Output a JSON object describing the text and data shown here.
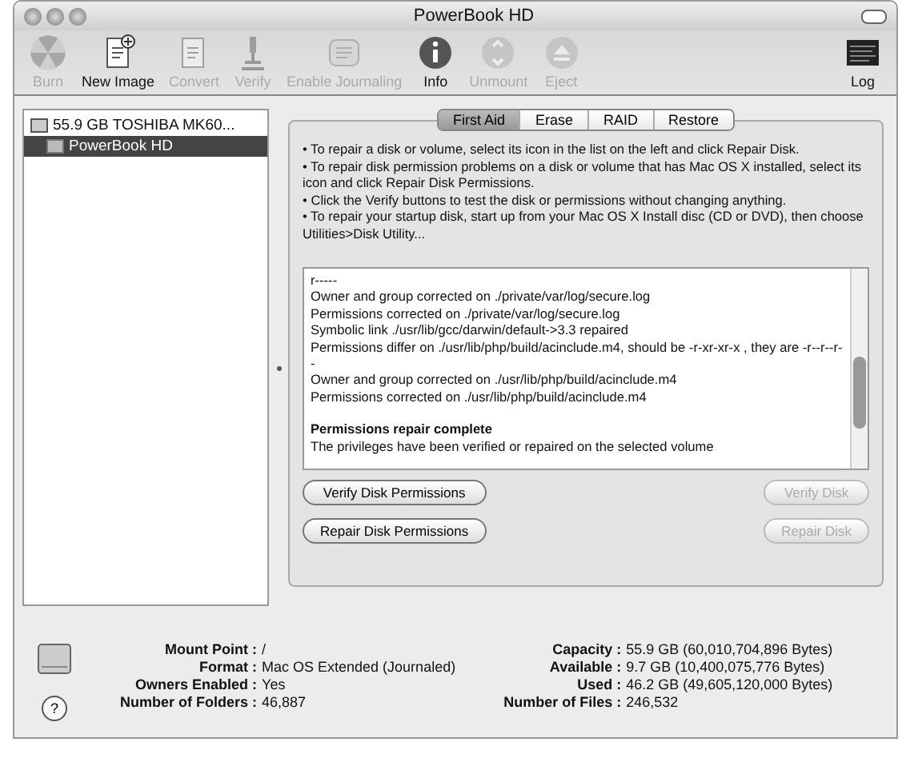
{
  "window": {
    "title": "PowerBook HD"
  },
  "toolbar": [
    {
      "label": "Burn",
      "disabled": true
    },
    {
      "label": "New Image",
      "disabled": false
    },
    {
      "label": "Convert",
      "disabled": true
    },
    {
      "label": "Verify",
      "disabled": true
    },
    {
      "label": "Enable Journaling",
      "disabled": true
    },
    {
      "label": "Info",
      "disabled": false
    },
    {
      "label": "Unmount",
      "disabled": true
    },
    {
      "label": "Eject",
      "disabled": true
    },
    {
      "label": "Log",
      "disabled": false
    }
  ],
  "sidebar": {
    "items": [
      {
        "label": "55.9 GB TOSHIBA MK60...",
        "selected": false,
        "children": [
          {
            "label": "PowerBook HD",
            "selected": true
          }
        ]
      }
    ]
  },
  "tabs": [
    {
      "label": "First Aid",
      "selected": true
    },
    {
      "label": "Erase",
      "selected": false
    },
    {
      "label": "RAID",
      "selected": false
    },
    {
      "label": "Restore",
      "selected": false
    }
  ],
  "instructions": [
    "• To repair a disk or volume, select its icon in the list on the left and click Repair Disk.",
    "• To repair disk permission problems on a disk or volume that has Mac OS X installed, select its icon and click Repair Disk Permissions.",
    "• Click the Verify buttons to test the disk or permissions without changing anything.",
    "• To repair your startup disk, start up from your Mac OS X Install disc (CD or DVD), then choose Utilities>Disk Utility..."
  ],
  "log": [
    {
      "kind": "line",
      "text": "r-----"
    },
    {
      "kind": "line",
      "text": "Owner and group corrected on ./private/var/log/secure.log"
    },
    {
      "kind": "line",
      "text": "Permissions corrected on ./private/var/log/secure.log"
    },
    {
      "kind": "line",
      "text": "Symbolic link ./usr/lib/gcc/darwin/default->3.3 repaired"
    },
    {
      "kind": "line",
      "text": "Permissions differ on ./usr/lib/php/build/acinclude.m4, should be -r-xr-xr-x , they are -r--r--r--"
    },
    {
      "kind": "line",
      "text": "Owner and group corrected on ./usr/lib/php/build/acinclude.m4"
    },
    {
      "kind": "line",
      "text": "Permissions corrected on ./usr/lib/php/build/acinclude.m4"
    },
    {
      "kind": "heading",
      "text": "Permissions repair complete"
    },
    {
      "kind": "line",
      "text": "The privileges have been verified or repaired on the selected volume"
    }
  ],
  "buttons": [
    {
      "label": "Verify Disk Permissions",
      "disabled": false
    },
    {
      "label": "Verify Disk",
      "disabled": true
    },
    {
      "label": "Repair Disk Permissions",
      "disabled": false
    },
    {
      "label": "Repair Disk",
      "disabled": true
    }
  ],
  "info_left": [
    {
      "label": "Mount Point :",
      "value": "/"
    },
    {
      "label": "Format :",
      "value": "Mac OS Extended (Journaled)"
    },
    {
      "label": "Owners Enabled :",
      "value": "Yes"
    },
    {
      "label": "Number of Folders :",
      "value": "46,887"
    }
  ],
  "info_right": [
    {
      "label": "Capacity :",
      "value": "55.9 GB (60,010,704,896 Bytes)"
    },
    {
      "label": "Available :",
      "value": "9.7 GB (10,400,075,776 Bytes)"
    },
    {
      "label": "Used :",
      "value": "46.2 GB (49,605,120,000 Bytes)"
    },
    {
      "label": "Number of Files :",
      "value": "246,532"
    }
  ],
  "help": {
    "label": "?"
  }
}
